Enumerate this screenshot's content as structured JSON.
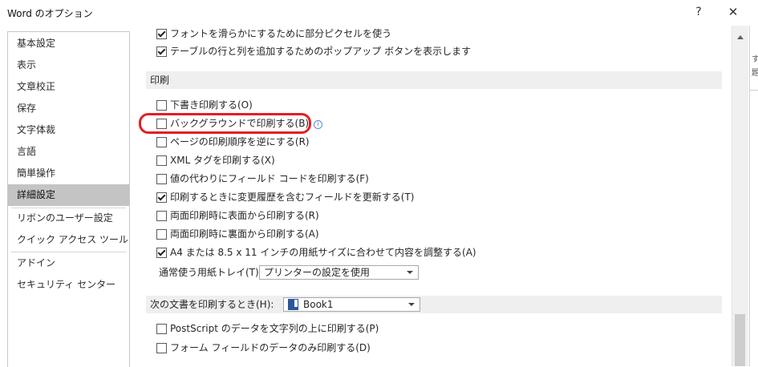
{
  "window": {
    "title": "Word のオプション",
    "help": "?",
    "close": "✕"
  },
  "sidebar": {
    "items": [
      {
        "label": "基本設定"
      },
      {
        "label": "表示"
      },
      {
        "label": "文章校正"
      },
      {
        "label": "保存"
      },
      {
        "label": "文字体裁"
      },
      {
        "label": "言語"
      },
      {
        "label": "簡単操作"
      },
      {
        "label": "詳細設定",
        "selected": true
      },
      {
        "label": "リボンのユーザー設定"
      },
      {
        "label": "クイック アクセス ツール バー"
      },
      {
        "label": "アドイン"
      },
      {
        "label": "セキュリティ センター"
      }
    ]
  },
  "display_options": [
    {
      "label": "フォントを滑らかにするために部分ピクセルを使う",
      "checked": true
    },
    {
      "label": "テーブルの行と列を追加するためのポップアップ ボタンを表示します",
      "checked": true
    }
  ],
  "print_section": {
    "header": "印刷",
    "options": [
      {
        "label": "下書き印刷する(O)",
        "checked": false
      },
      {
        "label": "バックグラウンドで印刷する(B)",
        "checked": false,
        "info": "i"
      },
      {
        "label": "ページの印刷順序を逆にする(R)",
        "checked": false
      },
      {
        "label": "XML タグを印刷する(X)",
        "checked": false
      },
      {
        "label": "値の代わりにフィールド コードを印刷する(F)",
        "checked": false
      },
      {
        "label": "印刷するときに変更履歴を含むフィールドを更新する(T)",
        "checked": true
      },
      {
        "label": "両面印刷時に表面から印刷する(R)",
        "checked": false
      },
      {
        "label": "両面印刷時に裏面から印刷する(A)",
        "checked": false
      },
      {
        "label": "A4 または 8.5 x 11 インチの用紙サイズに合わせて内容を調整する(A)",
        "checked": true
      }
    ],
    "tray_label": "通常使う用紙トレイ(T):",
    "tray_value": "プリンターの設定を使用"
  },
  "doc_print_section": {
    "header": "次の文書を印刷するとき(H):",
    "document": "Book1",
    "options": [
      {
        "label": "PostScript のデータを文字列の上に印刷する(P)",
        "checked": false
      },
      {
        "label": "フォーム フィールドのデータのみ印刷する(D)",
        "checked": false
      }
    ]
  },
  "right_edge": {
    "fragment": "す\n題"
  },
  "colors": {
    "highlight_ring": "#e31e24",
    "selected_nav": "#c4c4c4",
    "section_header_bg": "#efefef"
  }
}
